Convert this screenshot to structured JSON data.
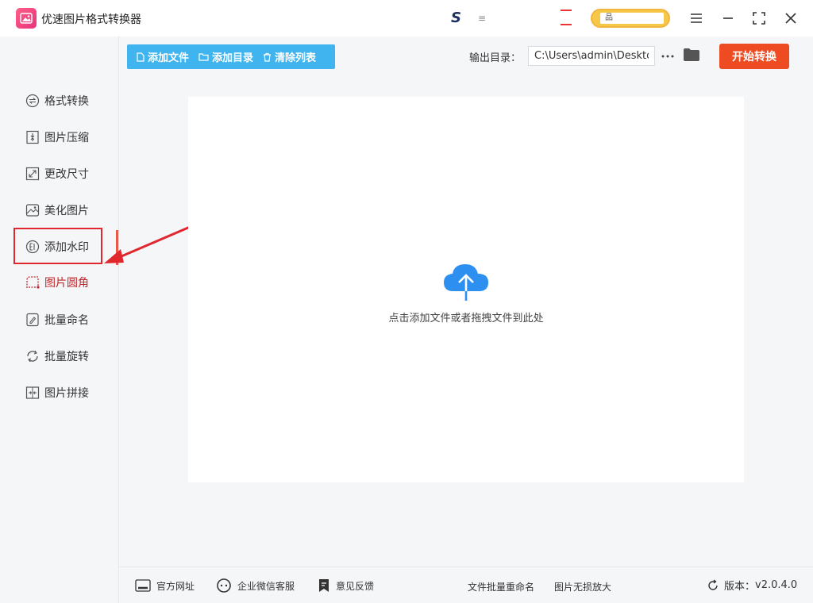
{
  "app": {
    "title": "优速图片格式转换器",
    "promo_letter": "S",
    "promo_text": "≡",
    "promo_pill": "品"
  },
  "sidebar": {
    "items": [
      {
        "label": "格式转换",
        "icon": "convert-icon"
      },
      {
        "label": "图片压缩",
        "icon": "compress-icon"
      },
      {
        "label": "更改尺寸",
        "icon": "resize-icon"
      },
      {
        "label": "美化图片",
        "icon": "beautify-icon"
      },
      {
        "label": "添加水印",
        "icon": "watermark-icon"
      },
      {
        "label": "图片圆角",
        "icon": "rounded-corner-icon"
      },
      {
        "label": "批量命名",
        "icon": "rename-icon"
      },
      {
        "label": "批量旋转",
        "icon": "rotate-icon"
      },
      {
        "label": "图片拼接",
        "icon": "merge-icon"
      }
    ],
    "active_index": 5
  },
  "toolbar": {
    "add_file": "添加文件",
    "add_dir": "添加目录",
    "clear_list": "清除列表"
  },
  "output": {
    "label": "输出目录：",
    "path": "C:\\Users\\admin\\Deskto",
    "start_label": "开始转换"
  },
  "drop": {
    "hint": "点击添加文件或者拖拽文件到此处"
  },
  "footer": {
    "website": "官方网址",
    "wechat": "企业微信客服",
    "feedback": "意见反馈",
    "batch_rename": "文件批量重命名",
    "lossless_zoom": "图片无损放大",
    "version_label": "版本：",
    "version": "v2.0.4.0"
  },
  "colors": {
    "accent_blue": "#3fb4ee",
    "start_orange": "#ef4b22",
    "highlight_red": "#e0272e",
    "cloud_blue": "#2d8ff0"
  }
}
